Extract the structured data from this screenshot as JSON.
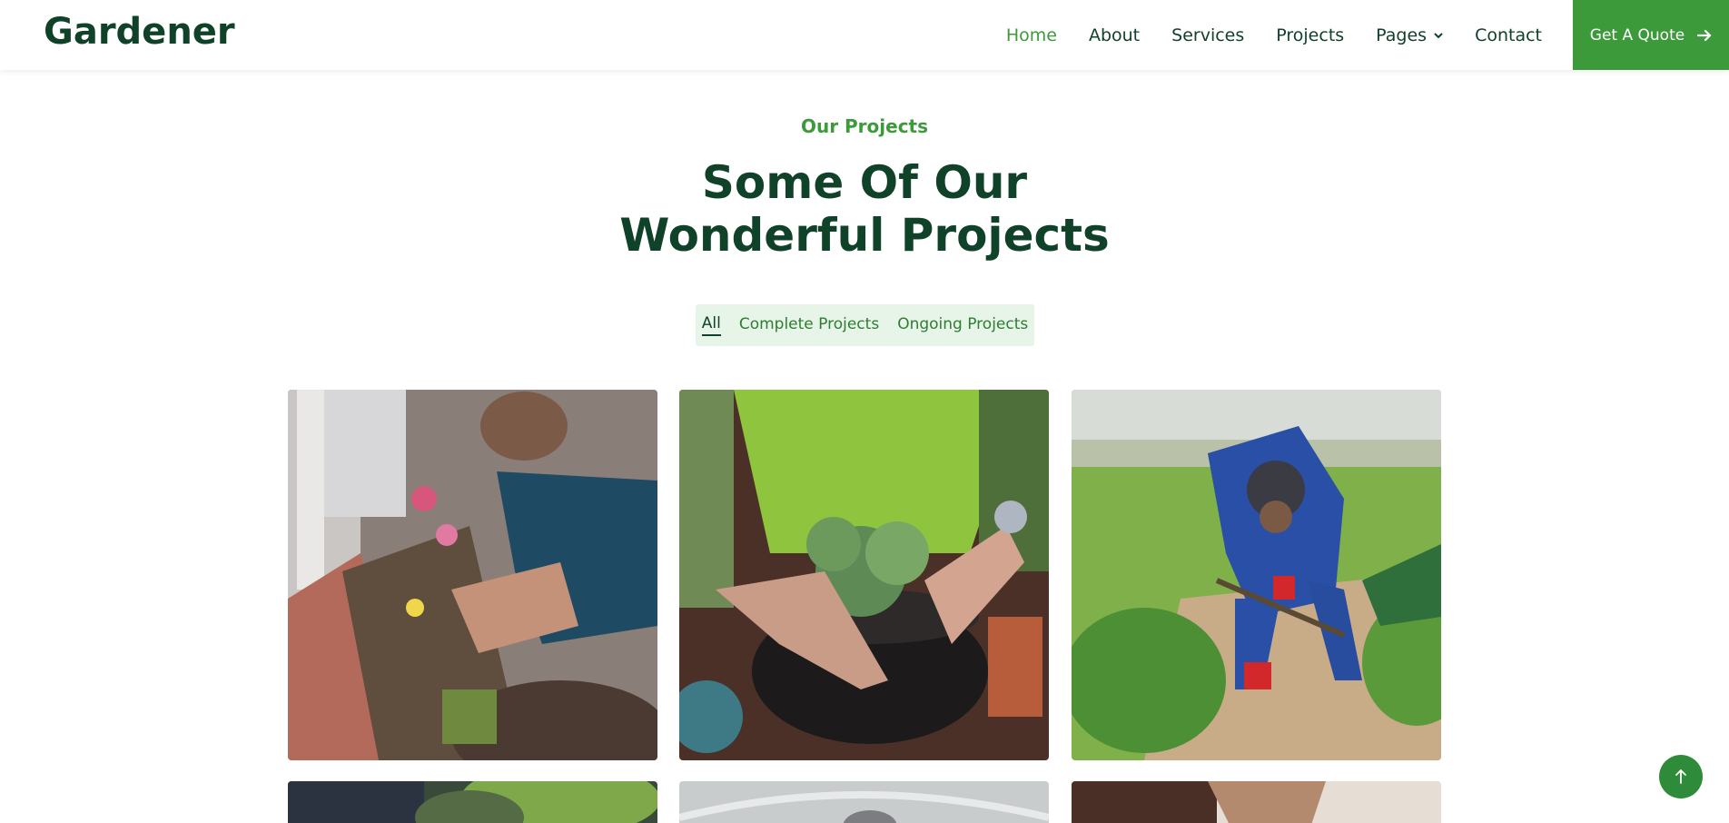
{
  "brand": "Gardener",
  "nav": {
    "items": [
      {
        "label": "Home",
        "active": true
      },
      {
        "label": "About",
        "active": false
      },
      {
        "label": "Services",
        "active": false
      },
      {
        "label": "Projects",
        "active": false
      },
      {
        "label": "Pages",
        "active": false,
        "dropdown": true
      },
      {
        "label": "Contact",
        "active": false
      }
    ],
    "quote_label": "Get A Quote",
    "quote_icon": "arrow-right-icon"
  },
  "section": {
    "eyebrow": "Our Projects",
    "title_line1": "Some Of Our",
    "title_line2": "Wonderful Projects"
  },
  "filters": [
    {
      "label": "All",
      "active": true
    },
    {
      "label": "Complete Projects",
      "active": false
    },
    {
      "label": "Ongoing Projects",
      "active": false
    }
  ],
  "projects": [
    {
      "name": "people planting flowers in a garden bed"
    },
    {
      "name": "hands potting succulents"
    },
    {
      "name": "worker in blue overalls gardening"
    },
    {
      "name": "project image 4"
    },
    {
      "name": "project image 5"
    },
    {
      "name": "project image 6"
    }
  ],
  "colors": {
    "brand_dark": "#0f4229",
    "accent_green": "#3c9a3a",
    "filter_bg": "#e7f4e8"
  },
  "back_to_top_icon": "arrow-up-icon"
}
